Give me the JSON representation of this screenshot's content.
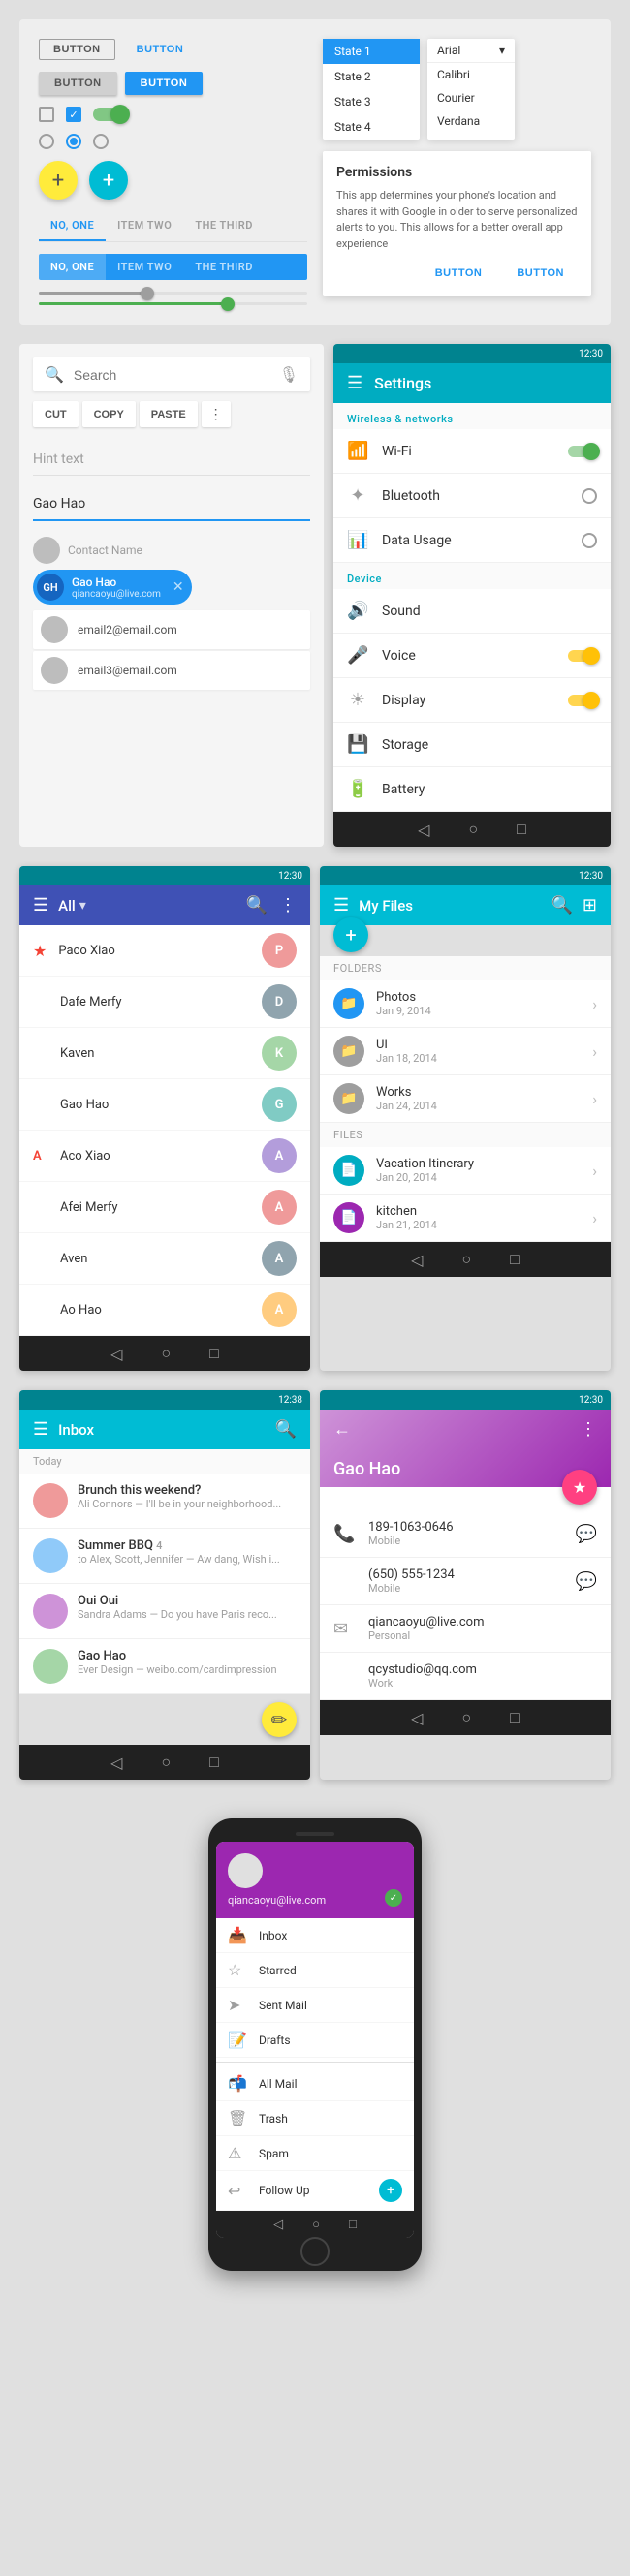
{
  "top_section": {
    "buttons": {
      "button_label": "BUTTON",
      "button_blue_label": "BUTTON",
      "button_raised_label": "BUTTON",
      "button_raised_blue_label": "BUTTON"
    },
    "tabs": {
      "item1": "NO, ONE",
      "item2": "ITEM TWO",
      "item3": "THE THIRD"
    },
    "state_dropdown": {
      "state1": "State 1",
      "state2": "State 2",
      "state3": "State 3",
      "state4": "State 4"
    },
    "font_dropdown": {
      "header": "Arial",
      "item1": "Calibri",
      "item2": "Courier",
      "item3": "Verdana"
    },
    "permissions": {
      "title": "Permissions",
      "text": "This app determines your phone's location and shares it with Google in older to serve personalized alerts to you. This allows for a better overall app experience",
      "btn1": "BUTTON",
      "btn2": "BUTTON"
    }
  },
  "search_section": {
    "placeholder": "Search",
    "hint_text": "Hint text",
    "active_text": "Gao Hao",
    "actions": {
      "cut": "CUT",
      "copy": "COPY",
      "paste": "PASTE"
    },
    "contact_label": "Contact Name",
    "chip": {
      "name": "Gao Hao",
      "email": "qiancaoyu@live.com"
    },
    "suggestions": {
      "email1": "email2@email.com",
      "email2": "email3@email.com"
    }
  },
  "settings_screen": {
    "title": "Settings",
    "time": "12:30",
    "sections": {
      "wireless": "Wireless & networks",
      "device": "Device"
    },
    "items": {
      "wifi": "Wi-Fi",
      "bluetooth": "Bluetooth",
      "data_usage": "Data Usage",
      "sound": "Sound",
      "voice": "Voice",
      "display": "Display",
      "storage": "Storage",
      "battery": "Battery"
    }
  },
  "contacts_screen": {
    "title": "All",
    "time": "12:30",
    "contacts": [
      {
        "name": "Paco Xiao",
        "star": true
      },
      {
        "name": "Dafe Merfy",
        "star": false
      },
      {
        "name": "Kaven",
        "star": false
      },
      {
        "name": "Gao Hao",
        "star": false
      },
      {
        "name": "Aco Xiao",
        "alpha": "A",
        "star": false
      },
      {
        "name": "Afei Merfy",
        "star": false
      },
      {
        "name": "Aven",
        "star": false
      },
      {
        "name": "Ao Hao",
        "star": false
      }
    ]
  },
  "files_screen": {
    "title": "My Files",
    "time": "12:30",
    "folders_label": "Folders",
    "files_label": "Files",
    "folders": [
      {
        "name": "Photos",
        "date": "Jan 9, 2014"
      },
      {
        "name": "UI",
        "date": "Jan 18, 2014"
      },
      {
        "name": "Works",
        "date": "Jan 24, 2014"
      }
    ],
    "files": [
      {
        "name": "Vacation Itinerary",
        "date": "Jan 20, 2014"
      },
      {
        "name": "kitchen",
        "date": "Jan 21, 2014"
      }
    ]
  },
  "inbox_screen": {
    "title": "Inbox",
    "time": "12:38",
    "date_header": "Today",
    "emails": [
      {
        "subject": "Brunch this weekend?",
        "sender": "Ali Connors",
        "preview": "I'll be in your neighborhood..."
      },
      {
        "subject": "Summer BBQ",
        "count": "4",
        "sender": "to Alex, Scott, Jennifer",
        "preview": "— Aw dang, Wish i..."
      },
      {
        "subject": "Oui Oui",
        "sender": "Sandra Adams",
        "preview": "— Do you have Paris reco..."
      },
      {
        "subject": "Gao Hao",
        "sender": "Ever Design",
        "preview": "— weibo.com/cardimpression"
      }
    ]
  },
  "contact_detail_screen": {
    "name": "Gao Hao",
    "time": "12:30",
    "phones": [
      {
        "number": "189-1063-0646",
        "label": "Mobile"
      },
      {
        "number": "(650) 555-1234",
        "label": "Mobile"
      }
    ],
    "emails": [
      {
        "address": "qiancaoyu@live.com",
        "label": "Personal"
      },
      {
        "address": "qcystudio@qq.com",
        "label": "Work"
      }
    ]
  },
  "drawer_screen": {
    "email": "qiancaoyu@live.com",
    "items": [
      {
        "label": "Inbox",
        "icon": "inbox"
      },
      {
        "label": "Starred",
        "icon": "star"
      },
      {
        "label": "Sent Mail",
        "icon": "send"
      },
      {
        "label": "Drafts",
        "icon": "drafts"
      }
    ],
    "all_mail": {
      "label": "All Mail",
      "count": ""
    },
    "trash": {
      "label": "Trash",
      "count": ""
    },
    "spam": {
      "label": "Spam",
      "count": ""
    },
    "follow_up": {
      "label": "Follow Up",
      "count": ""
    }
  }
}
